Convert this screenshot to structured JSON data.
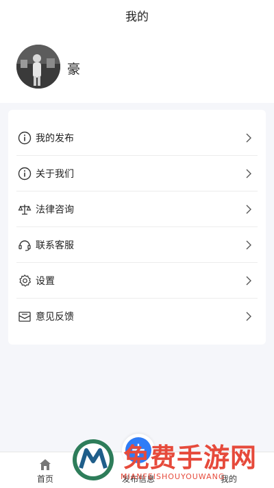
{
  "header": {
    "title": "我的"
  },
  "profile": {
    "username": "豪"
  },
  "menu": {
    "items": [
      {
        "label": "我的发布",
        "icon": "info-icon"
      },
      {
        "label": "关于我们",
        "icon": "info-icon"
      },
      {
        "label": "法律咨询",
        "icon": "scale-icon"
      },
      {
        "label": "联系客服",
        "icon": "headset-icon"
      },
      {
        "label": "设置",
        "icon": "gear-icon"
      },
      {
        "label": "意见反馈",
        "icon": "feedback-mail-icon"
      }
    ]
  },
  "tabbar": {
    "home_label": "首页",
    "publish_label": "发布信息",
    "mine_label": "我的"
  },
  "watermark": {
    "text": "免费手游网",
    "sub": "MIANFEISHOUYOUWANG"
  },
  "colors": {
    "accent": "#2f7cf6",
    "watermark": "#e64a3b",
    "background": "#f5f6fa"
  }
}
